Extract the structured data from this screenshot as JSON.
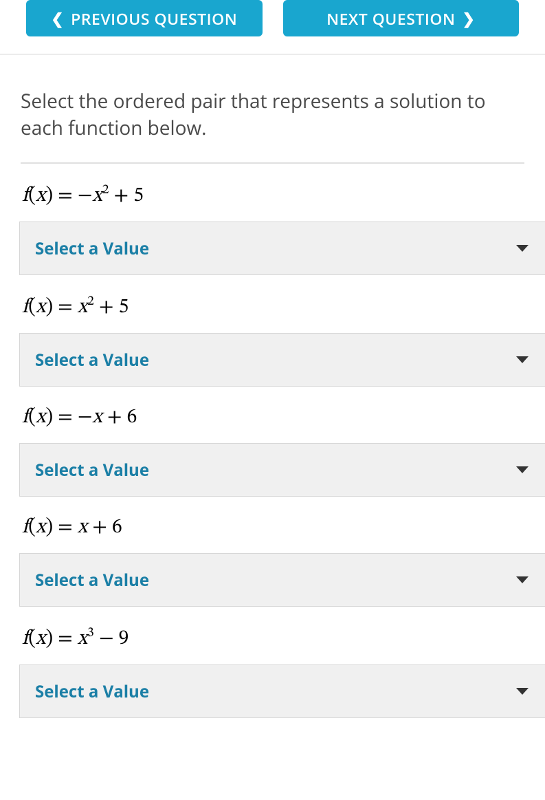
{
  "nav": {
    "prev_label": "PREVIOUS QUESTION",
    "next_label": "NEXT QUESTION"
  },
  "prompt": "Select the ordered pair that represents a solution to each function below.",
  "select_placeholder": "Select a Value",
  "functions": [
    {
      "display_html": "<span>f</span><span class='rm'>(</span><span>x</span><span class='rm'>)</span> <span class='rm'>=</span> <span class='rm'>−</span><span>x</span><sup>2</sup> <span class='rm'>+ 5</span>",
      "plain": "f(x) = -x^2 + 5"
    },
    {
      "display_html": "<span>f</span><span class='rm'>(</span><span>x</span><span class='rm'>)</span> <span class='rm'>=</span> <span>x</span><sup>2</sup> <span class='rm'>+ 5</span>",
      "plain": "f(x) = x^2 + 5"
    },
    {
      "display_html": "<span>f</span><span class='rm'>(</span><span>x</span><span class='rm'>)</span> <span class='rm'>=</span> <span class='rm'>−</span><span>x</span> <span class='rm'>+ 6</span>",
      "plain": "f(x) = -x + 6"
    },
    {
      "display_html": "<span>f</span><span class='rm'>(</span><span>x</span><span class='rm'>)</span> <span class='rm'>=</span> <span>x</span> <span class='rm'>+ 6</span>",
      "plain": "f(x) = x + 6"
    },
    {
      "display_html": "<span>f</span><span class='rm'>(</span><span>x</span><span class='rm'>)</span> <span class='rm'>=</span> <span>x</span><sup>3</sup> <span class='rm'>− 9</span>",
      "plain": "f(x) = x^3 - 9"
    }
  ]
}
